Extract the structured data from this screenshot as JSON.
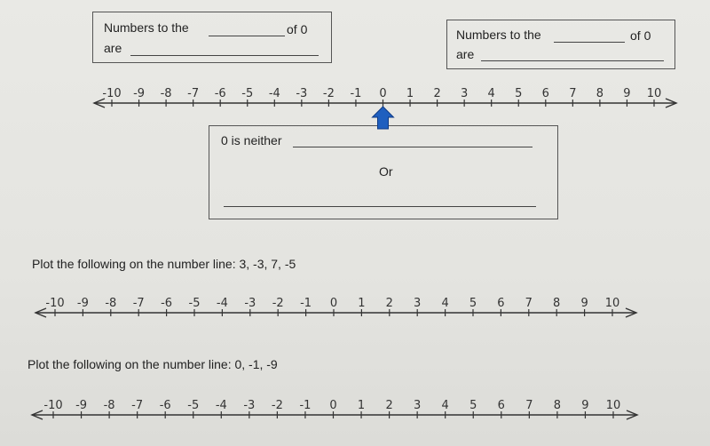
{
  "worksheet": {
    "left_box": {
      "line1_start": "Numbers to the",
      "line1_end": "of 0",
      "line2_start": "are"
    },
    "right_box": {
      "line1_start": "Numbers to the",
      "line1_end": "of 0",
      "line2_start": "are"
    },
    "center_box": {
      "line1_start": "0 is neither",
      "middle": "Or"
    },
    "arrow_marker": {
      "points_to": "0",
      "color": "#1f5fbf"
    },
    "number_lines": [
      {
        "id": "top",
        "min": -10,
        "max": 10,
        "labels": [
          "-10",
          "-9",
          "-8",
          "-7",
          "-6",
          "-5",
          "-4",
          "-3",
          "-2",
          "-1",
          "0",
          "1",
          "2",
          "3",
          "4",
          "5",
          "6",
          "7",
          "8",
          "9",
          "10"
        ]
      },
      {
        "id": "second",
        "min": -10,
        "max": 10,
        "labels": [
          "-10",
          "-9",
          "-8",
          "-7",
          "-6",
          "-5",
          "-4",
          "-3",
          "-2",
          "-1",
          "0",
          "1",
          "2",
          "3",
          "4",
          "5",
          "6",
          "7",
          "8",
          "9",
          "10"
        ]
      },
      {
        "id": "third",
        "min": -10,
        "max": 10,
        "labels": [
          "-10",
          "-9",
          "-8",
          "-7",
          "-6",
          "-5",
          "-4",
          "-3",
          "-2",
          "-1",
          "0",
          "1",
          "2",
          "3",
          "4",
          "5",
          "6",
          "7",
          "8",
          "9",
          "10"
        ]
      }
    ],
    "prompts": [
      "Plot the following on the number line: 3, -3, 7, -5",
      "Plot the following on the number line: 0, -1, -9"
    ]
  }
}
